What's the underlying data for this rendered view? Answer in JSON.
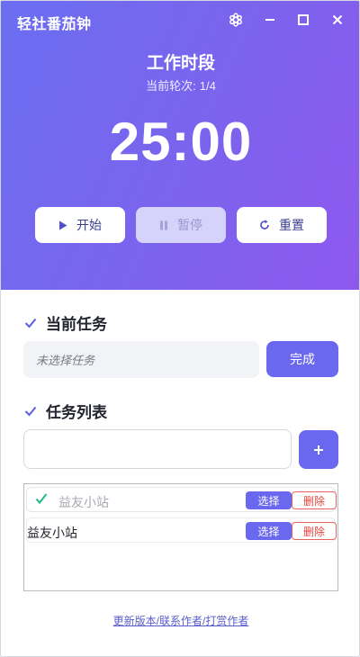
{
  "titlebar": {
    "title": "轻社番茄钟",
    "icons": [
      "settings-icon",
      "minimize-icon",
      "maximize-icon",
      "close-icon"
    ]
  },
  "timer": {
    "phase_title": "工作时段",
    "round_label": "当前轮次:",
    "round_value": "1/4",
    "display": "25:00"
  },
  "controls": {
    "start_label": "开始",
    "pause_label": "暂停",
    "reset_label": "重置"
  },
  "current_task": {
    "heading": "当前任务",
    "placeholder": "未选择任务",
    "complete_label": "完成"
  },
  "task_list": {
    "heading": "任务列表",
    "input_value": "",
    "items": [
      {
        "name": "益友小站",
        "completed": true,
        "select_label": "选择",
        "delete_label": "删除"
      },
      {
        "name": "益友小站",
        "completed": false,
        "select_label": "选择",
        "delete_label": "删除"
      }
    ]
  },
  "footer": {
    "link_text": "更新版本/联系作者/打赏作者"
  },
  "colors": {
    "gradient_start": "#6a6ef0",
    "gradient_end": "#8f58ee",
    "accent": "#6a68ef",
    "danger": "#e0453d",
    "check": "#1fb98a"
  }
}
